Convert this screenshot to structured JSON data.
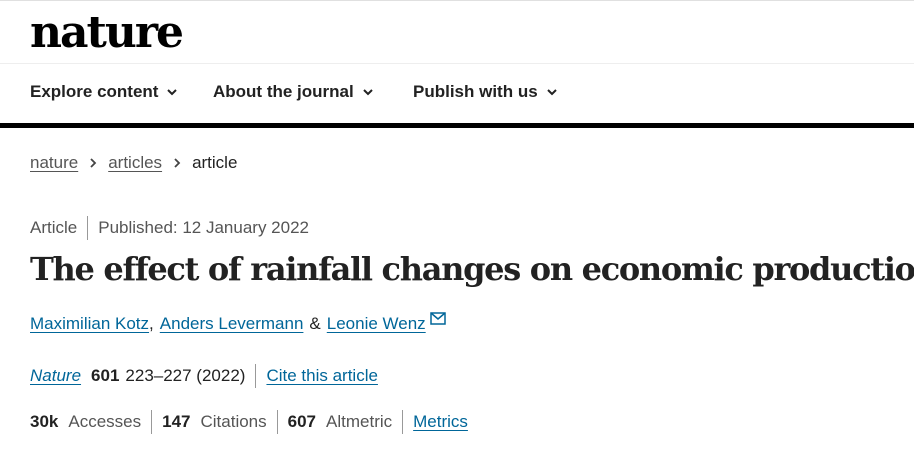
{
  "header": {
    "logo": "nature"
  },
  "nav": {
    "items": [
      {
        "label": "Explore content"
      },
      {
        "label": "About the journal"
      },
      {
        "label": "Publish with us"
      }
    ]
  },
  "breadcrumb": {
    "items": [
      "nature",
      "articles"
    ],
    "current": "article"
  },
  "article": {
    "type": "Article",
    "published": "Published: 12 January 2022",
    "title": "The effect of rainfall changes on economic production",
    "authors": [
      "Maximilian Kotz",
      "Anders Levermann",
      "Leonie Wenz"
    ],
    "author_separator_1": ",",
    "author_separator_2": "&",
    "journal": "Nature",
    "volume": "601",
    "pages_year": "223–227 (2022)",
    "cite_label": "Cite this article"
  },
  "metrics": {
    "accesses_value": "30k",
    "accesses_label": "Accesses",
    "citations_value": "147",
    "citations_label": "Citations",
    "altmetric_value": "607",
    "altmetric_label": "Altmetric",
    "metrics_link": "Metrics"
  },
  "colors": {
    "link": "#006699",
    "text": "#222222",
    "muted": "#555555",
    "rule": "#000000"
  },
  "icons": [
    "chevron-down-icon",
    "chevron-right-icon",
    "envelope-icon"
  ]
}
